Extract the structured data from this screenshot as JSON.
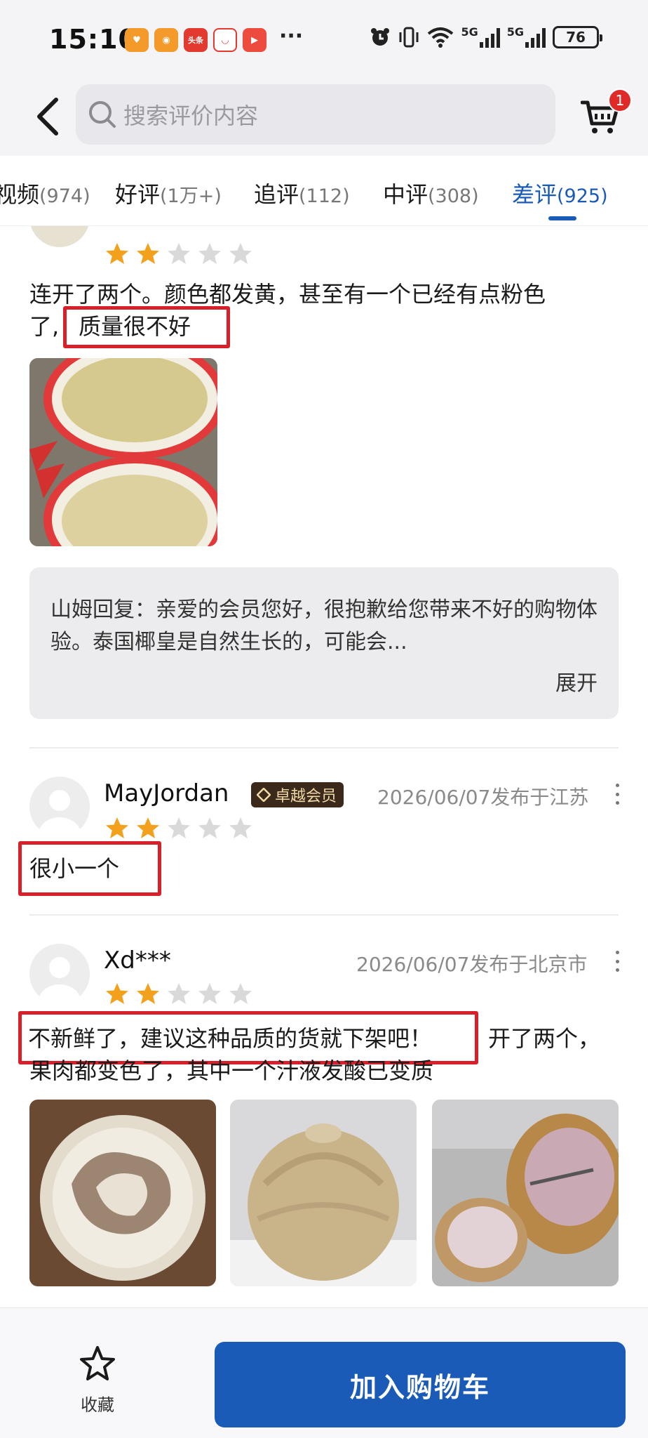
{
  "status_bar": {
    "time": "15:10",
    "dots": "···",
    "signal_1": "5G",
    "signal_2": "5G",
    "battery": "76"
  },
  "search": {
    "placeholder": "搜索评价内容"
  },
  "cart": {
    "badge_count": "1"
  },
  "tabs": [
    {
      "label": "视频",
      "count": "(974)"
    },
    {
      "label": "好评",
      "count": "(1万+)"
    },
    {
      "label": "追评",
      "count": "(112)"
    },
    {
      "label": "中评",
      "count": "(308)"
    },
    {
      "label": "差评",
      "count": "(925)",
      "active": true
    }
  ],
  "reviews": [
    {
      "rating": 2,
      "text_line1": "连开了两个。颜色都发黄，甚至有一个已经有点粉色",
      "text_line2_prefix": "了,",
      "highlight": "质量很不好",
      "reply_text": "山姆回复：亲爱的会员您好，很抱歉给您带来不好的购物体验。泰国椰皇是自然生长的，可能会...",
      "reply_expand": "展开"
    },
    {
      "username": "MayJordan",
      "member_badge": "卓越会员",
      "meta": "2026/06/07发布于江苏",
      "rating": 2,
      "highlight": "很小一个"
    },
    {
      "username": "Xd***",
      "meta": "2026/06/07发布于北京市",
      "rating": 2,
      "highlight": "不新鲜了，建议这种品质的货就下架吧！",
      "text_tail": "开了两个，",
      "text_line2": "果肉都变色了，其中一个汁液发酸已变质"
    }
  ],
  "bottom_bar": {
    "favorite_label": "收藏",
    "add_to_cart_label": "加入购物车"
  },
  "colors": {
    "accent": "#1a5bb8",
    "highlight_border": "#d8202a",
    "star_filled": "#f3a11d",
    "star_empty": "#d9d9d9"
  }
}
